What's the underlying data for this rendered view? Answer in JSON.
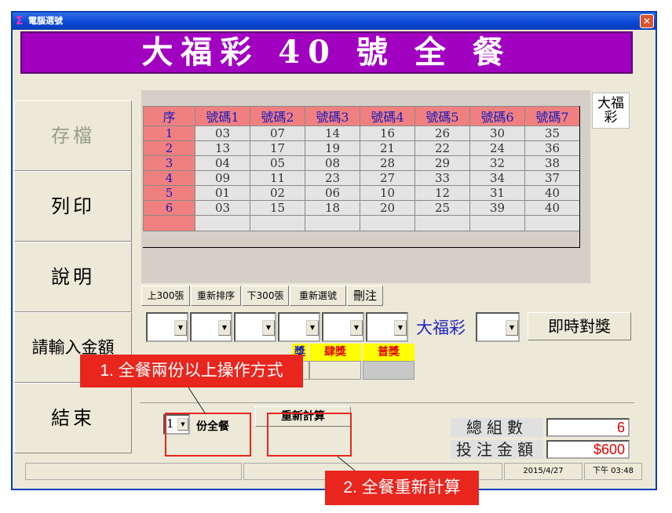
{
  "window": {
    "title": "電腦選號",
    "close": "✕"
  },
  "banner": {
    "title": "大福彩 40 號 全 餐"
  },
  "side_buttons": {
    "save": "存檔",
    "print": "列印",
    "help": "說明",
    "amount": "請輸入金額",
    "exit": "結束"
  },
  "grid": {
    "headers": [
      "序",
      "號碼1",
      "號碼2",
      "號碼3",
      "號碼4",
      "號碼5",
      "號碼6",
      "號碼7"
    ],
    "rows": [
      [
        "1",
        "03",
        "07",
        "14",
        "16",
        "26",
        "30",
        "35"
      ],
      [
        "2",
        "13",
        "17",
        "19",
        "21",
        "22",
        "24",
        "36"
      ],
      [
        "3",
        "04",
        "05",
        "08",
        "28",
        "29",
        "32",
        "38"
      ],
      [
        "4",
        "09",
        "11",
        "23",
        "27",
        "33",
        "34",
        "37"
      ],
      [
        "5",
        "01",
        "02",
        "06",
        "10",
        "12",
        "31",
        "40"
      ],
      [
        "6",
        "03",
        "15",
        "18",
        "20",
        "25",
        "39",
        "40"
      ]
    ]
  },
  "badge": {
    "line1": "大福",
    "line2": "彩"
  },
  "toolbar": {
    "prev300": "上300張",
    "resort": "重新排序",
    "next300": "下300張",
    "reselect": "重新選號",
    "delete": "刪注"
  },
  "lottery_label": "大福彩",
  "check_button": "即時對獎",
  "prizes": {
    "partial": "獎",
    "fourth": "肆獎",
    "general": "普獎"
  },
  "sets": {
    "value": "1",
    "label": "份全餐"
  },
  "recalc_button": "重新計算",
  "summary": {
    "total_label": "總組數",
    "total_value": "6",
    "amount_label": "投注金額",
    "amount_value": "$600"
  },
  "status": {
    "date": "2015/4/27",
    "time": "下午 03:48"
  },
  "callouts": {
    "one": "1. 全餐兩份以上操作方式",
    "two": "2. 全餐重新計算"
  }
}
